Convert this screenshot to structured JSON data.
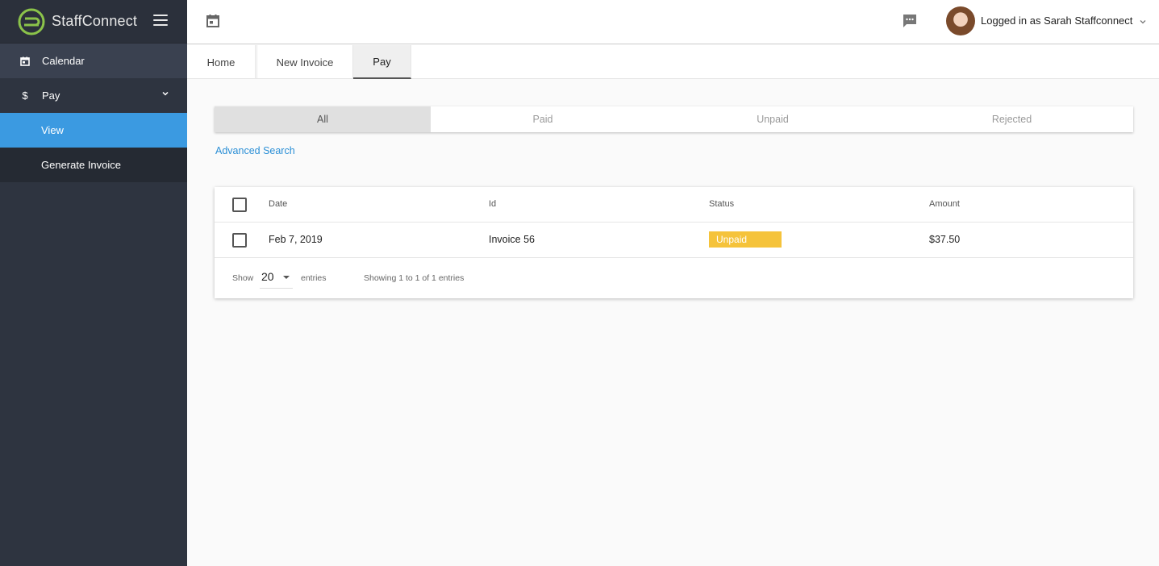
{
  "brand": {
    "name": "StaffConnect"
  },
  "sidebar": {
    "items": [
      {
        "label": "Calendar",
        "icon": "calendar-icon"
      },
      {
        "label": "Pay",
        "icon": "dollar-icon"
      },
      {
        "label": "View"
      },
      {
        "label": "Generate Invoice"
      }
    ]
  },
  "header": {
    "user_label": "Logged in as Sarah Staffconnect"
  },
  "tabs": [
    {
      "label": "Home"
    },
    {
      "label": "New Invoice"
    },
    {
      "label": "Pay",
      "active": true
    }
  ],
  "filters": [
    "All",
    "Paid",
    "Unpaid",
    "Rejected"
  ],
  "advanced_search": "Advanced Search",
  "table": {
    "columns": [
      "Date",
      "Id",
      "Status",
      "Amount"
    ],
    "rows": [
      {
        "date": "Feb 7, 2019",
        "id": "Invoice 56",
        "status": "Unpaid",
        "amount": "$37.50"
      }
    ]
  },
  "pagination": {
    "show_label": "Show",
    "page_size": "20",
    "entries_label": "entries",
    "info": "Showing 1 to 1 of 1 entries"
  },
  "colors": {
    "accent": "#3b9ae1",
    "sidebar": "#2e3440",
    "status_unpaid": "#f5c33b",
    "logo_green": "#8bc34a"
  }
}
